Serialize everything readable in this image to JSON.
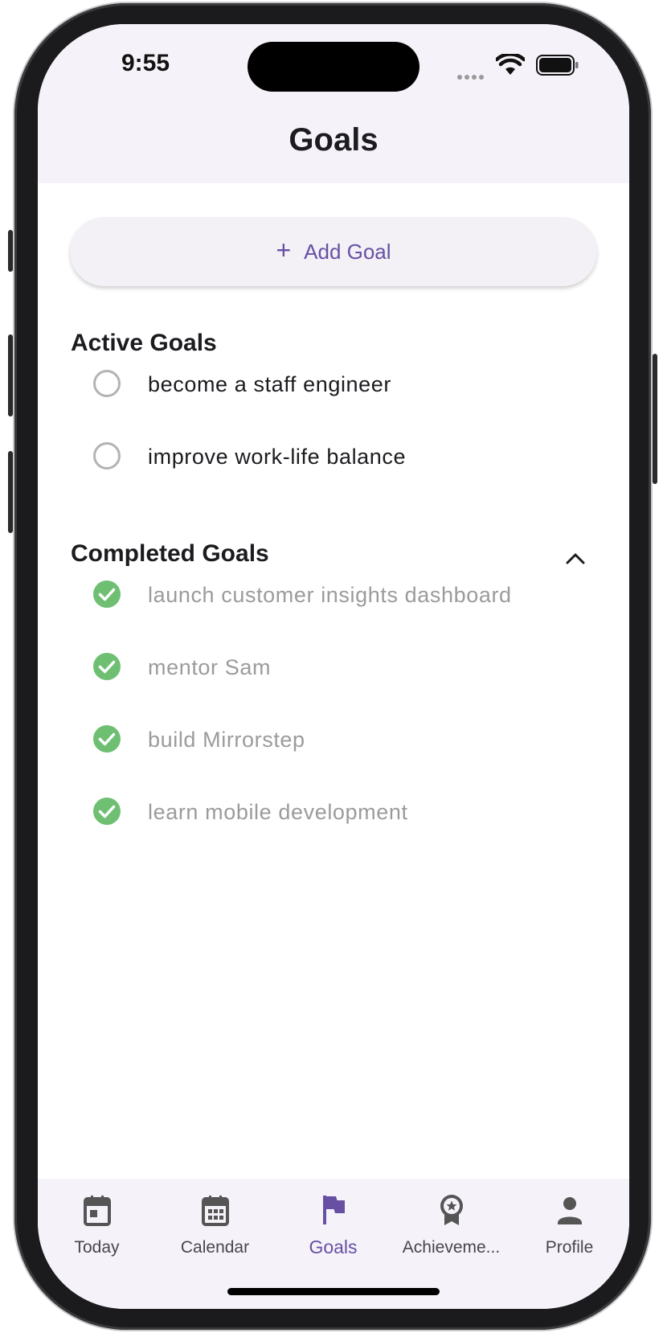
{
  "status_bar": {
    "time": "9:55"
  },
  "header": {
    "title": "Goals"
  },
  "add_goal": {
    "icon": "plus-icon",
    "label": "Add Goal"
  },
  "active_section": {
    "title": "Active Goals",
    "items": [
      {
        "label": "become a staff engineer",
        "completed": false
      },
      {
        "label": "improve work-life balance",
        "completed": false
      }
    ]
  },
  "completed_section": {
    "title": "Completed Goals",
    "expanded": true,
    "items": [
      {
        "label": "launch customer insights dashboard",
        "completed": true
      },
      {
        "label": "mentor Sam",
        "completed": true
      },
      {
        "label": "build Mirrorstep",
        "completed": true
      },
      {
        "label": "learn mobile development",
        "completed": true
      }
    ]
  },
  "bottom_nav": {
    "selected": "Goals",
    "items": [
      {
        "label": "Today",
        "icon": "today-calendar-icon"
      },
      {
        "label": "Calendar",
        "icon": "calendar-month-icon"
      },
      {
        "label": "Goals",
        "icon": "flag-icon"
      },
      {
        "label": "Achieveme...",
        "icon": "award-badge-icon"
      },
      {
        "label": "Profile",
        "icon": "person-icon"
      }
    ]
  },
  "colors": {
    "accent": "#6750a4",
    "completed_check": "#6fbf73",
    "header_bg": "#f6f2f9"
  }
}
